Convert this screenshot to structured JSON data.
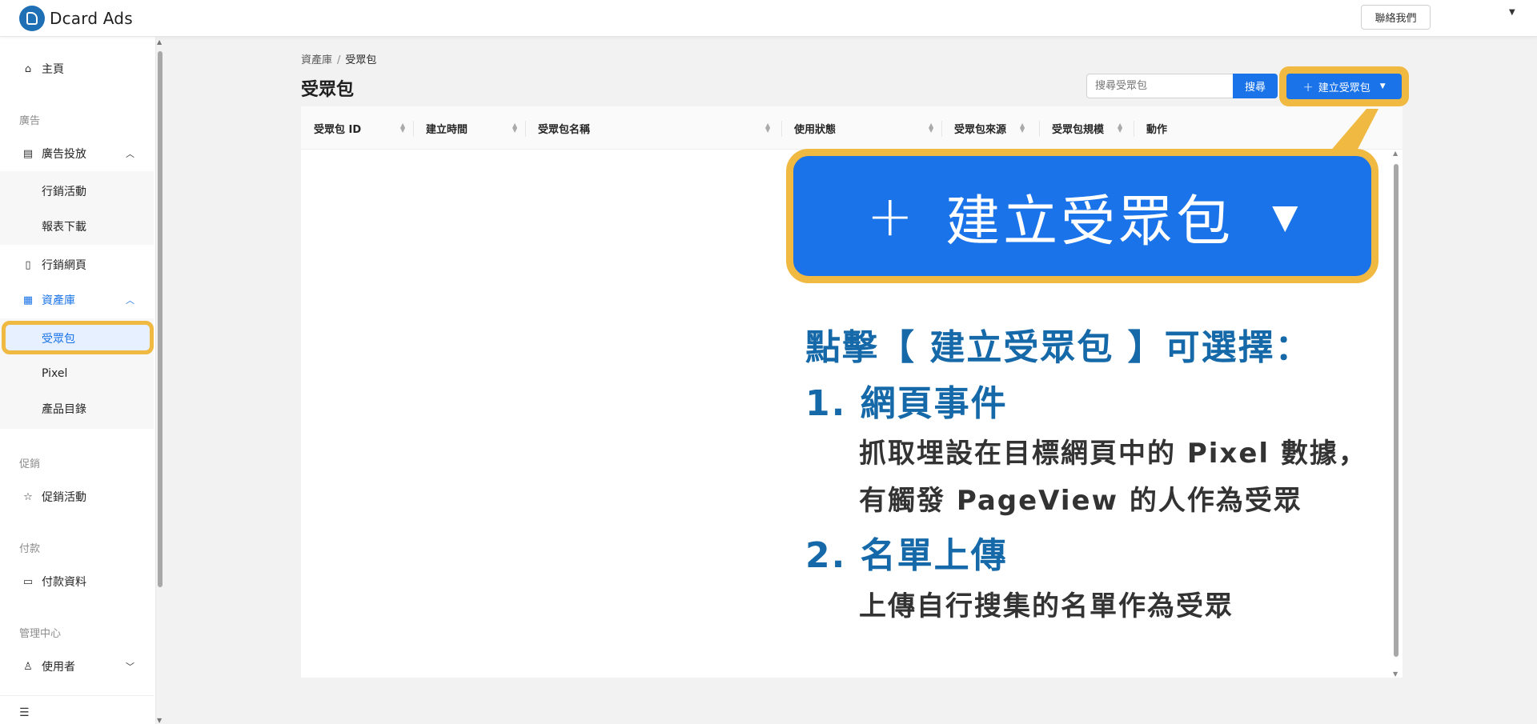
{
  "app": {
    "name": "Dcard Ads"
  },
  "header": {
    "contact_label": "聯絡我們"
  },
  "sidebar": {
    "home": "主頁",
    "section_ads": "廣告",
    "ad_delivery": "廣告投放",
    "campaigns": "行銷活動",
    "reports": "報表下載",
    "landing_pages": "行銷網頁",
    "asset_library": "資產庫",
    "audiences": "受眾包",
    "pixel": "Pixel",
    "catalog": "產品目錄",
    "section_promo": "促銷",
    "promotions": "促銷活動",
    "section_payment": "付款",
    "payment_info": "付款資料",
    "section_admin": "管理中心",
    "users": "使用者"
  },
  "breadcrumb": {
    "parent": "資產庫",
    "separator": "/",
    "current": "受眾包"
  },
  "page": {
    "title": "受眾包"
  },
  "search": {
    "placeholder": "搜尋受眾包",
    "button_label": "搜尋"
  },
  "create_button": {
    "label": "建立受眾包"
  },
  "table": {
    "columns": [
      "受眾包 ID",
      "建立時間",
      "受眾包名稱",
      "使用狀態",
      "受眾包來源",
      "受眾包規模",
      "動作"
    ],
    "rows": []
  },
  "callout": {
    "button_label": "建立受眾包",
    "heading": "點擊【 建立受眾包 】可選擇：",
    "option1_title": "1. 網頁事件",
    "option1_desc_line1": "抓取埋設在目標網頁中的 Pixel 數據，",
    "option1_desc_line2": "有觸發 PageView 的人作為受眾",
    "option2_title": "2. 名單上傳",
    "option2_desc": "上傳自行搜集的名單作為受眾"
  },
  "colors": {
    "primary": "#1a73e8",
    "highlight": "#f0b942",
    "annotation_blue": "#1669a8"
  },
  "icons": [
    "home-icon",
    "calendar-icon",
    "phone-icon",
    "book-icon",
    "star-icon",
    "card-icon",
    "user-icon",
    "collapse-menu-icon",
    "chevron-up-icon",
    "chevron-down-icon",
    "sort-icon",
    "plus-icon",
    "caret-down-icon"
  ]
}
